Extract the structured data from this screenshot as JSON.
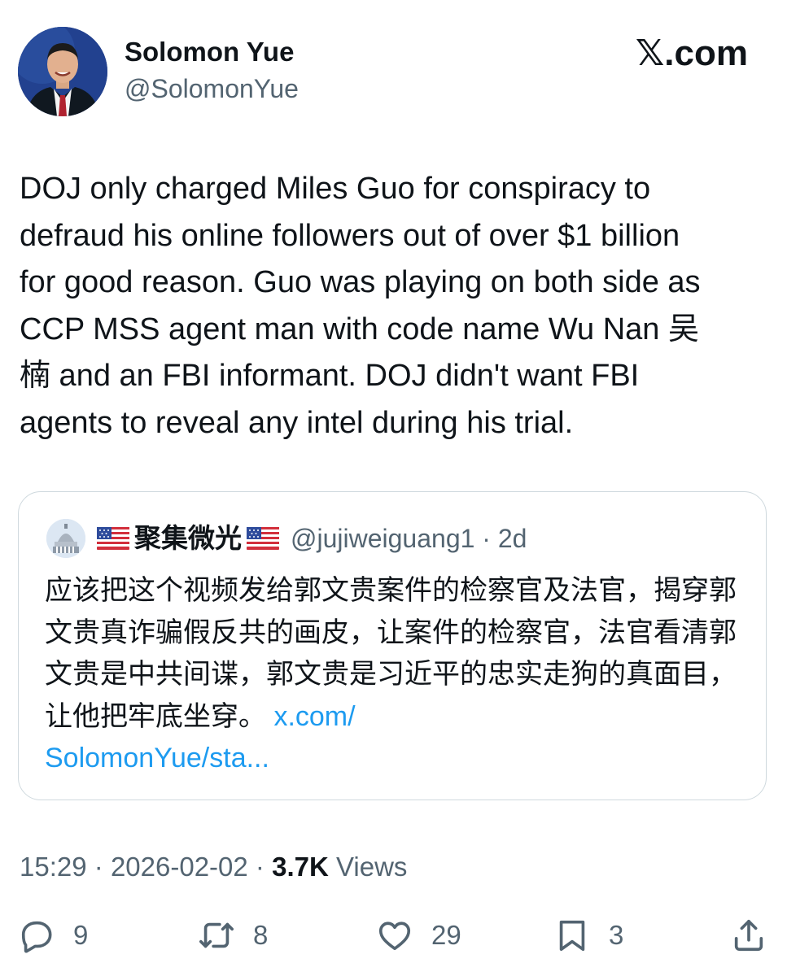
{
  "tweet": {
    "author": {
      "name": "Solomon Yue",
      "handle": "@SolomonYue"
    },
    "brand": "𝕏.com",
    "text": "DOJ only charged Miles Guo for conspiracy to\ndefraud his online followers out of over $1 billion\nfor good reason. Guo was playing on both side as\nCCP MSS agent man with code name Wu Nan 吴\n楠 and an FBI informant. DOJ didn't want FBI\nagents to reveal any intel during his trial.",
    "quote": {
      "name": "聚集微光",
      "handle": "@jujiweiguang1 · 2d",
      "text": "应该把这个视频发给郭文贵案件的检察官及法官，揭穿郭文贵真诈骗假反共的画皮，让案件的检察官，法官看清郭文贵是中共间谍，郭文贵是习近平的忠实走狗的真面目，让他把牢底坐穿。",
      "link": "x.com/\nSolomonYue/sta..."
    },
    "meta": {
      "time": "15:29",
      "date": "2026-02-02",
      "views_count": "3.7K",
      "views_label": "Views",
      "separator": "·"
    },
    "actions": {
      "replies": "9",
      "reposts": "8",
      "likes": "29",
      "bookmarks": "3"
    },
    "icons": {
      "reply": "reply-icon",
      "repost": "repost-icon",
      "like": "heart-icon",
      "bookmark": "bookmark-icon",
      "share": "share-icon"
    },
    "colors": {
      "text": "#0f1419",
      "secondary": "#536471",
      "link": "#1d9bf0",
      "border": "#cfd9de"
    }
  }
}
